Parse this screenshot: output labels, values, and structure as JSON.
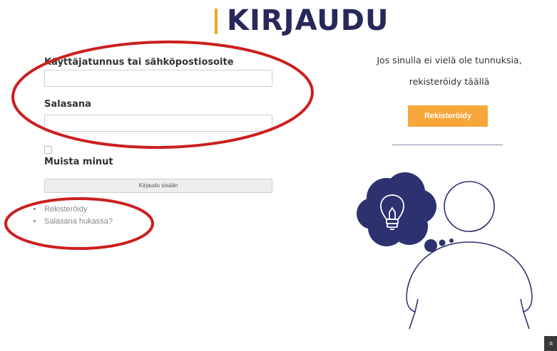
{
  "header": {
    "title": "KIRJAUDU"
  },
  "login_form": {
    "username_label": "Käyttäjatunnus tai sähköpostiosoite",
    "username_value": "",
    "password_label": "Salasana",
    "password_value": "",
    "remember_label": "Muista minut",
    "remember_checked": false,
    "submit_label": "Kirjaudu sisään"
  },
  "links": {
    "register": "Rekisteröidy",
    "lost_password": "Salasana hukassa?"
  },
  "register_panel": {
    "line1": "Jos sinulla ei vielä ole tunnuksia,",
    "line2": "rekisteröidy täällä",
    "button_label": "Rekisteröidy"
  },
  "scroll_top": {
    "icon": "double-chevron-up-icon",
    "glyph": "«"
  },
  "colors": {
    "title": "#27295a",
    "accent": "#f5a623",
    "annotation": "#cc1f1f",
    "illustration": "#2e3170"
  }
}
